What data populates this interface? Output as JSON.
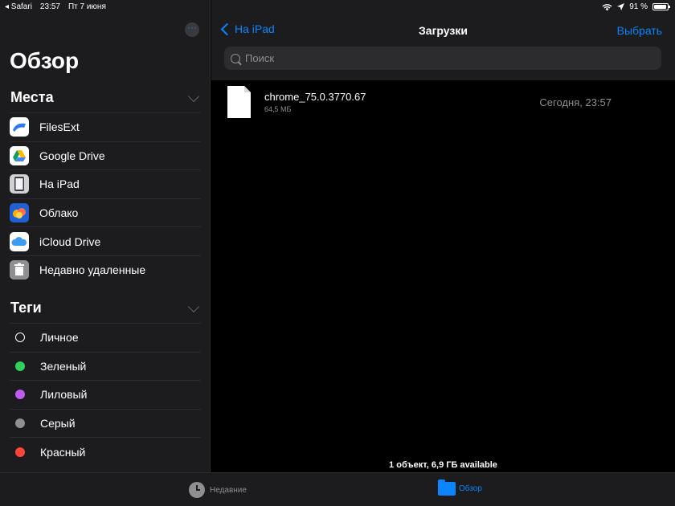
{
  "status_bar": {
    "back_app": "◂ Safari",
    "time": "23:57",
    "date": "Пт 7 июня",
    "battery_text": "91 %",
    "battery_level": 0.91
  },
  "sidebar": {
    "title": "Обзор",
    "places_header": "Места",
    "places": [
      {
        "label": "FilesExt",
        "icon": "filesext-icon",
        "color": "#2f7bf6"
      },
      {
        "label": "Google Drive",
        "icon": "google-drive-icon",
        "color": "#ffffff"
      },
      {
        "label": "На iPad",
        "icon": "ipad-icon",
        "color": "#d0d0d5"
      },
      {
        "label": "Облако",
        "icon": "cloud-icon",
        "color": "#1f5fd8"
      },
      {
        "label": "iCloud Drive",
        "icon": "icloud-icon",
        "color": "#ffffff"
      },
      {
        "label": "Недавно удаленные",
        "icon": "trash-icon",
        "color": "#8e8e93"
      }
    ],
    "tags_header": "Теги",
    "tags": [
      {
        "label": "Личное",
        "color": "none"
      },
      {
        "label": "Зеленый",
        "color": "#30d158"
      },
      {
        "label": "Лиловый",
        "color": "#bf5af2"
      },
      {
        "label": "Серый",
        "color": "#8e8e93"
      },
      {
        "label": "Красный",
        "color": "#ff453a"
      }
    ]
  },
  "main": {
    "back_label": "На iPad",
    "title": "Загрузки",
    "select_label": "Выбрать",
    "search_placeholder": "Поиск",
    "files": [
      {
        "name": "chrome_75.0.3770.67",
        "size": "64,5 МБ",
        "date": "Сегодня, 23:57"
      }
    ],
    "footer": "1 объект, 6,9 ГБ available"
  },
  "tabbar": {
    "recent_label": "Недавние",
    "browse_label": "Обзор"
  }
}
